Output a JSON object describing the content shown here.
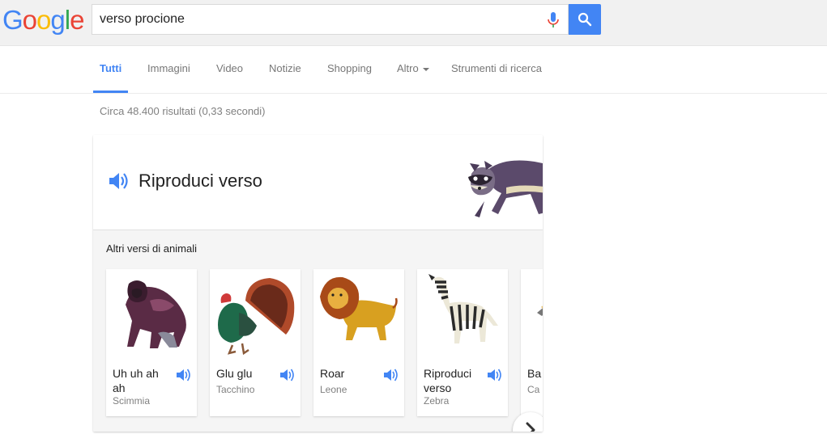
{
  "logo": {
    "letters": [
      "G",
      "o",
      "o",
      "g",
      "l",
      "e"
    ],
    "colors": [
      "#4285f4",
      "#ea4335",
      "#fbbc05",
      "#4285f4",
      "#34a853",
      "#ea4335"
    ]
  },
  "search": {
    "query": "verso procione"
  },
  "tabs": [
    {
      "label": "Tutti",
      "active": true
    },
    {
      "label": "Immagini"
    },
    {
      "label": "Video"
    },
    {
      "label": "Notizie"
    },
    {
      "label": "Shopping"
    },
    {
      "label": "Altro"
    },
    {
      "label": "Strumenti di ricerca"
    }
  ],
  "stats": "Circa 48.400 risultati (0,33 secondi)",
  "card": {
    "play_label": "Riproduci verso",
    "others_title": "Altri versi di animali",
    "animals": [
      {
        "sound": "Uh uh ah ah",
        "name": "Scimmia",
        "icon": "gorilla-icon"
      },
      {
        "sound": "Glu glu",
        "name": "Tacchino",
        "icon": "turkey-icon"
      },
      {
        "sound": "Roar",
        "name": "Leone",
        "icon": "lion-icon"
      },
      {
        "sound": "Riproduci verso",
        "name": "Zebra",
        "icon": "zebra-icon"
      },
      {
        "sound": "Ba",
        "name": "Ca",
        "icon": "animal-icon"
      }
    ]
  },
  "colors": {
    "accent": "#4285f4",
    "page_bg": "#f1f1f1"
  }
}
